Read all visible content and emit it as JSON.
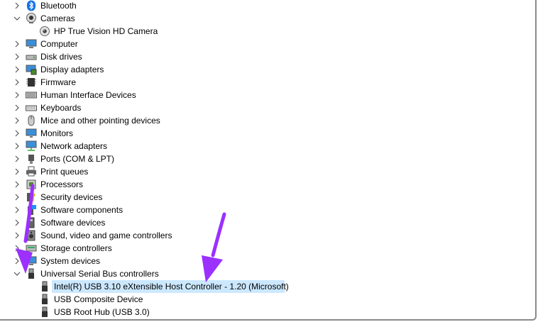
{
  "tree": {
    "items": [
      {
        "label": "Bluetooth",
        "icon": "bluetooth-icon",
        "state": "collapsed"
      },
      {
        "label": "Cameras",
        "icon": "camera-icon",
        "state": "expanded"
      },
      {
        "label": "HP True Vision HD Camera",
        "icon": "webcam-icon",
        "state": "child"
      },
      {
        "label": "Computer",
        "icon": "computer-icon",
        "state": "collapsed"
      },
      {
        "label": "Disk drives",
        "icon": "disk-drive-icon",
        "state": "collapsed"
      },
      {
        "label": "Display adapters",
        "icon": "display-adapter-icon",
        "state": "collapsed"
      },
      {
        "label": "Firmware",
        "icon": "firmware-icon",
        "state": "collapsed"
      },
      {
        "label": "Human Interface Devices",
        "icon": "hid-icon",
        "state": "collapsed"
      },
      {
        "label": "Keyboards",
        "icon": "keyboard-icon",
        "state": "collapsed"
      },
      {
        "label": "Mice and other pointing devices",
        "icon": "mouse-icon",
        "state": "collapsed"
      },
      {
        "label": "Monitors",
        "icon": "monitor-icon",
        "state": "collapsed"
      },
      {
        "label": "Network adapters",
        "icon": "network-icon",
        "state": "collapsed"
      },
      {
        "label": "Ports (COM & LPT)",
        "icon": "port-icon",
        "state": "collapsed"
      },
      {
        "label": "Print queues",
        "icon": "printer-icon",
        "state": "collapsed"
      },
      {
        "label": "Processors",
        "icon": "processor-icon",
        "state": "collapsed"
      },
      {
        "label": "Security devices",
        "icon": "security-icon",
        "state": "collapsed"
      },
      {
        "label": "Software components",
        "icon": "software-component-icon",
        "state": "collapsed"
      },
      {
        "label": "Software devices",
        "icon": "software-device-icon",
        "state": "collapsed"
      },
      {
        "label": "Sound, video and game controllers",
        "icon": "sound-icon",
        "state": "collapsed"
      },
      {
        "label": "Storage controllers",
        "icon": "storage-icon",
        "state": "collapsed"
      },
      {
        "label": "System devices",
        "icon": "system-icon",
        "state": "collapsed"
      },
      {
        "label": "Universal Serial Bus controllers",
        "icon": "usb-icon",
        "state": "expanded"
      },
      {
        "label": "Intel(R) USB 3.10 eXtensible Host Controller - 1.20 (Microsoft)",
        "icon": "usb-icon",
        "state": "child",
        "selected": true
      },
      {
        "label": "USB Composite Device",
        "icon": "usb-icon",
        "state": "child"
      },
      {
        "label": "USB Root Hub (USB 3.0)",
        "icon": "usb-icon",
        "state": "child"
      }
    ]
  },
  "colors": {
    "selection": "#cce8ff",
    "annotation_arrow": "#9b30ff"
  }
}
